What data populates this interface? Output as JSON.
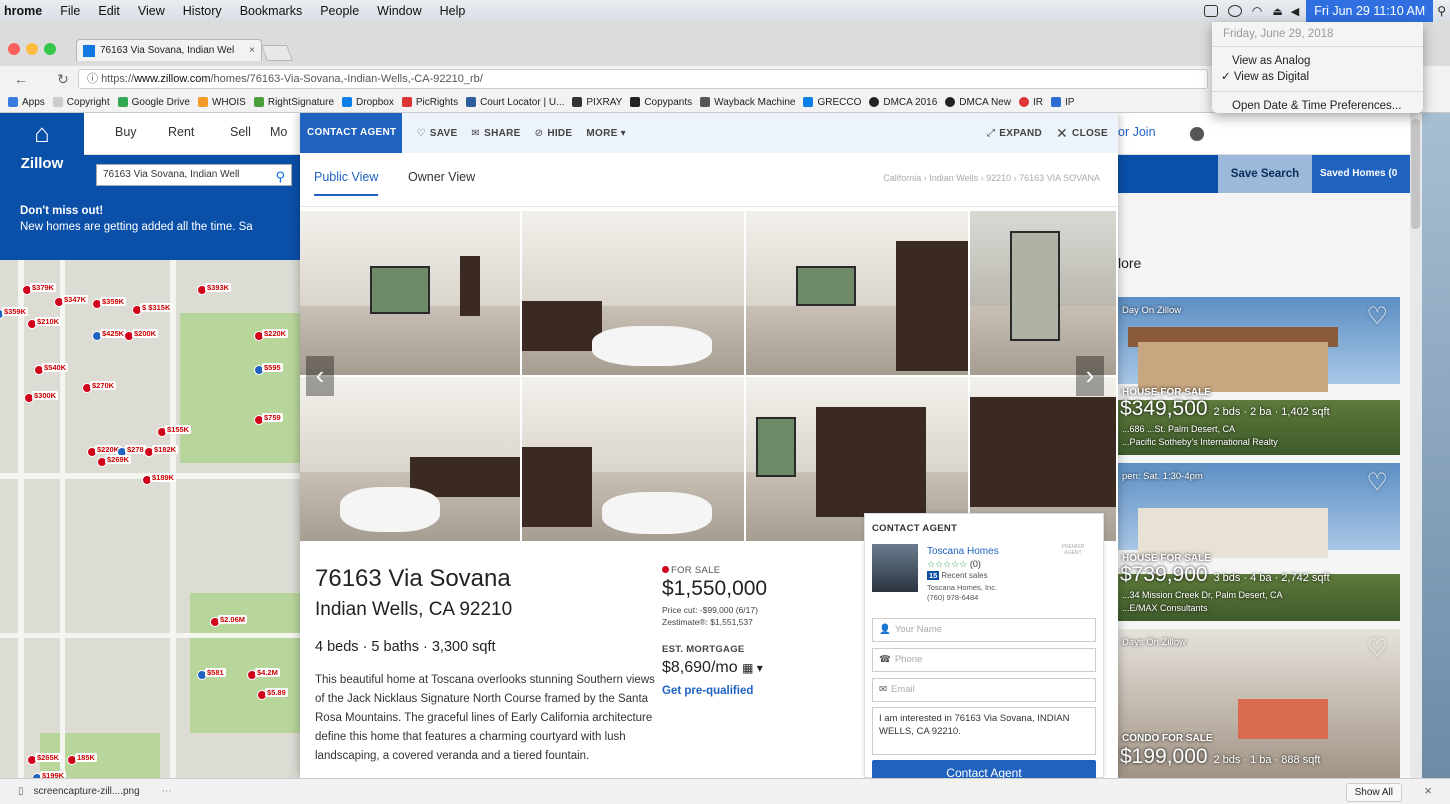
{
  "menubar": {
    "app": "hrome",
    "items": [
      "File",
      "Edit",
      "View",
      "History",
      "Bookmarks",
      "People",
      "Window",
      "Help"
    ],
    "clock": "Fri Jun 29  11:10 AM"
  },
  "date_menu": {
    "date": "Friday, June 29, 2018",
    "analog": "View as Analog",
    "digital": "✓ View as Digital",
    "prefs": "Open Date & Time Preferences..."
  },
  "browser": {
    "tab_title": "76163 Via Sovana, Indian Wel",
    "tab_close": "×",
    "url_prefix": "https://",
    "url_domain": "www.zillow.com",
    "url_path": "/homes/76163-Via-Sovana,-Indian-Wells,-CA-92210_rb/",
    "bookmarks": [
      "Apps",
      "Copyright",
      "Google Drive",
      "WHOIS",
      "RightSignature",
      "Dropbox",
      "PicRights",
      "Court Locator | U...",
      "PIXRAY",
      "Copypants",
      "Wayback Machine",
      "GRECCO",
      "DMCA 2016",
      "DMCA New",
      "IR",
      "IP"
    ]
  },
  "zillow": {
    "logo": "Zillow",
    "nav": [
      "Buy",
      "Rent",
      "Sell",
      "Mo"
    ],
    "join": "or Join",
    "search_value": "76163 Via Sovana, Indian Well",
    "save_search": "Save Search",
    "saved_homes": "Saved Homes (0",
    "banner_title": "Don't miss out!",
    "banner_text": "New homes are getting added all the time. Sa",
    "more_label": "lore",
    "map_labels": [
      "$379K",
      "$347K",
      "$359K",
      "$359K",
      "$ $315K",
      "$393K",
      "$210K",
      "$425K",
      "$200K",
      "$220K",
      "$540K",
      "$270K",
      "$595",
      "$300K",
      "$759",
      "$155K",
      "$220K",
      "$278",
      "$182K",
      "$269K",
      "$189K",
      "$2.06M",
      "$581",
      "$4.2M",
      "$5.89",
      "$265K",
      "185K",
      "$199K"
    ]
  },
  "listings": [
    {
      "tag": "Day On Zillow",
      "type": "HOUSE FOR SALE",
      "price": "$349,500",
      "specs": "2 bds · 2 ba · 1,402 sqft",
      "addr": "...686 ...St. Palm Desert, CA",
      "brk": "...Pacific Sotheby's International Realty"
    },
    {
      "tag": "pen: Sat. 1:30-4pm",
      "type": "HOUSE FOR SALE",
      "price": "$739,900",
      "specs": "3 bds · 4 ba · 2,742 sqft",
      "addr": "...34 Mission Creek Dr, Palm Desert, CA",
      "brk": "...E/MAX Consultants"
    },
    {
      "tag": "Days On Zillow",
      "type": "CONDO FOR SALE",
      "price": "$199,000",
      "specs": "2 bds · 1 ba · 888 sqft",
      "addr": "",
      "brk": ""
    }
  ],
  "modal": {
    "toolbar": {
      "contact": "CONTACT AGENT",
      "save": "SAVE",
      "share": "SHARE",
      "hide": "HIDE",
      "more": "MORE",
      "expand": "EXPAND",
      "close": "CLOSE"
    },
    "tabs": [
      "Public View",
      "Owner View"
    ],
    "breadcrumb": "California › Indian Wells › 92210 › 76163 VIA SOVANA",
    "address_line1": "76163 Via Sovana",
    "address_line2": "Indian Wells, CA 92210",
    "facts": "4 beds · 5 baths · 3,300 sqft",
    "description": "This beautiful home at Toscana overlooks stunning Southern views of the Jack Nicklaus Signature North Course framed by the Santa Rosa Mountains. The graceful lines of Early California architecture define this home that features a charming courtyard with lush landscaping, a covered veranda and a tiered fountain.",
    "status": "FOR SALE",
    "price": "$1,550,000",
    "price_cut": "Price cut: -$99,000 (6/17)",
    "zestimate": "Zestimate®: $1,551,537",
    "mortgage_label": "EST. MORTGAGE",
    "mortgage_value": "$8,690/mo",
    "prequal": "Get pre-qualified"
  },
  "agent": {
    "header": "CONTACT AGENT",
    "name": "Toscana Homes",
    "rating": "☆☆☆☆☆",
    "reviews": "(0)",
    "recent_count": "15",
    "recent_label": "Recent sales",
    "broker": "Toscana Homes, Inc.",
    "phone": "(760) 978-6484",
    "premier": "PREMIER AGENT",
    "name_placeholder": "Your Name",
    "phone_placeholder": "Phone",
    "email_placeholder": "Email",
    "message": "I am interested in 76163 Via Sovana, INDIAN WELLS, CA 92210.",
    "button": "Contact Agent"
  },
  "downloads": {
    "file": "screencapture-zill....png",
    "show_all": "Show All",
    "close": "×"
  }
}
